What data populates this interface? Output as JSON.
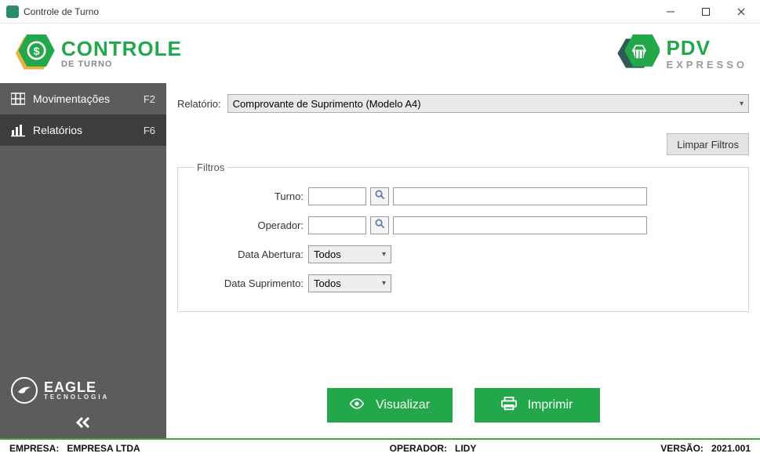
{
  "window": {
    "title": "Controle de Turno"
  },
  "brand_left": {
    "line1": "CONTROLE",
    "line2": "DE TURNO"
  },
  "brand_right": {
    "line1": "PDV",
    "line2": "EXPRESSO"
  },
  "sidebar": {
    "items": [
      {
        "label": "Movimentações",
        "hotkey": "F2"
      },
      {
        "label": "Relatórios",
        "hotkey": "F6"
      }
    ],
    "eagle": {
      "line1": "EAGLE",
      "line2": "TECNOLOGIA"
    }
  },
  "report": {
    "label": "Relatório:",
    "selected": "Comprovante de Suprimento (Modelo A4)"
  },
  "buttons": {
    "clear_filters": "Limpar Filtros",
    "view": "Visualizar",
    "print": "Imprimir"
  },
  "filters": {
    "legend": "Filtros",
    "turno": {
      "label": "Turno:",
      "code": "",
      "desc": ""
    },
    "operador": {
      "label": "Operador:",
      "code": "",
      "desc": ""
    },
    "data_abertura": {
      "label": "Data Abertura:",
      "value": "Todos"
    },
    "data_suprimento": {
      "label": "Data Suprimento:",
      "value": "Todos"
    }
  },
  "statusbar": {
    "empresa_label": "EMPRESA:",
    "empresa_value": "EMPRESA LTDA",
    "operador_label": "OPERADOR:",
    "operador_value": "LIDY",
    "versao_label": "VERSÃO:",
    "versao_value": "2021.001"
  }
}
